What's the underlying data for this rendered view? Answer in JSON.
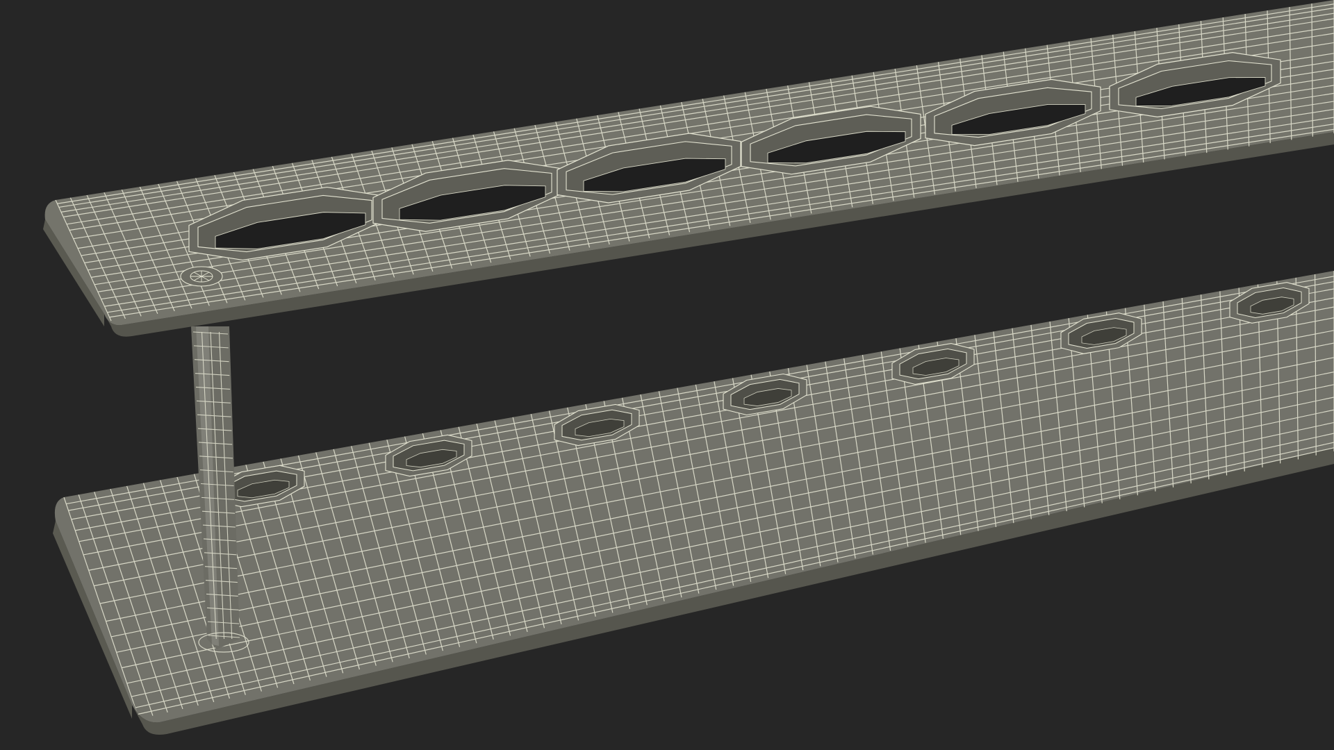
{
  "scene": {
    "subject": "wireframe-test-tube-rack",
    "background_color": "#262626",
    "surface_color": "#74746a",
    "surface_dark_color": "#5c5c53",
    "edge_color": "#4e4e46",
    "hole_color": "#222222",
    "wire_color": "#e4e4d2",
    "top_plate_holes": 6,
    "bottom_plate_sockets": 7
  }
}
